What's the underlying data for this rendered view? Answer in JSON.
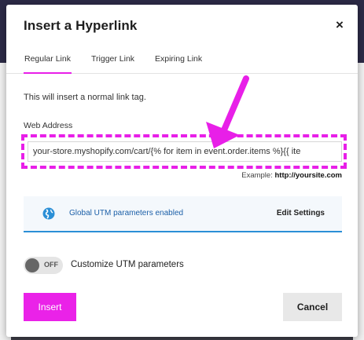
{
  "modal": {
    "title": "Insert a Hyperlink",
    "close_glyph": "×"
  },
  "tabs": [
    {
      "label": "Regular Link",
      "active": true
    },
    {
      "label": "Trigger Link",
      "active": false
    },
    {
      "label": "Expiring Link",
      "active": false
    }
  ],
  "intro_text": "This will insert a normal link tag.",
  "web_address": {
    "label": "Web Address",
    "value": "your-store.myshopify.com/cart/{% for item in event.order.items %}{{ ite",
    "example_prefix": "Example:",
    "example_value": "http://yoursite.com"
  },
  "utm_banner": {
    "icon": "globe-icon",
    "text": "Global UTM parameters enabled",
    "action": "Edit Settings"
  },
  "utm_toggle": {
    "state_text": "OFF",
    "label": "Customize UTM parameters",
    "on": false
  },
  "buttons": {
    "insert": "Insert",
    "cancel": "Cancel"
  },
  "colors": {
    "accent": "#e81fe8",
    "utm_blue": "#2b8fd6"
  }
}
